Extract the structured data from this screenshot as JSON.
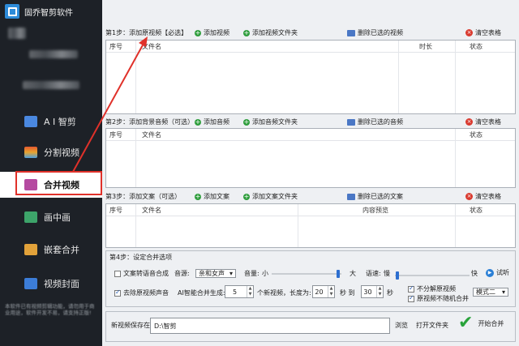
{
  "app": {
    "title": "固乔智剪软件"
  },
  "sidebar": {
    "items": [
      {
        "label": "A I 智剪",
        "icon": "ai-icon",
        "color": "#4a88e0"
      },
      {
        "label": "分割视频",
        "icon": "split-icon",
        "color": "#e6592f"
      },
      {
        "label": "合并视频",
        "icon": "merge-icon",
        "color": "#b54aa0",
        "active": true
      },
      {
        "label": "画中画",
        "icon": "pip-icon",
        "color": "#3da46a"
      },
      {
        "label": "嵌套合并",
        "icon": "nest-icon",
        "color": "#e2a23a"
      },
      {
        "label": "视频封面",
        "icon": "cover-icon",
        "color": "#3c7dd8"
      }
    ],
    "footer": "本软件已有视频剪辑功能，请勿用于商业用途，软件开发不易，请支持正版!"
  },
  "step1": {
    "title": "第1步：添加原视频【必选】",
    "add": "添加视频",
    "add_folder": "添加视频文件夹",
    "delete": "删除已选的视频",
    "clear": "清空表格",
    "columns": [
      "序号",
      "文件名",
      "时长",
      "状态"
    ]
  },
  "step2": {
    "title": "第2步：添加背景音频（可选）",
    "add": "添加音频",
    "add_folder": "添加音频文件夹",
    "delete": "删除已选的音频",
    "clear": "清空表格",
    "columns": [
      "序号",
      "文件名",
      "状态"
    ]
  },
  "step3": {
    "title": "第3步：添加文案（可选）",
    "add": "添加文案",
    "add_folder": "添加文案文件夹",
    "delete": "删除已选的文案",
    "clear": "清空表格",
    "columns": [
      "序号",
      "文件名",
      "内容预览",
      "状态"
    ]
  },
  "step4": {
    "title": "第4步：设定合并选项",
    "tts_label": "文案转语音合成",
    "voice_label": "音源:",
    "voice_value": "亲和女声",
    "volume_label": "音量:",
    "volume_min": "小",
    "volume_max": "大",
    "volume_level": 0.95,
    "speed_label": "语速:",
    "speed_min": "慢",
    "speed_max": "快",
    "speed_level": 0.03,
    "try_label": "试听",
    "remove_audio_label": "去除原视频声音",
    "ai_label": "AI智能合并生成:",
    "count_value": "5",
    "count_unit": "个新视频，长度为:",
    "len_from": "20",
    "len_sep": "秒 到",
    "len_to": "30",
    "len_unit": "秒",
    "no_split_label": "不分解原视频",
    "no_random_label": "原视频不随机合并",
    "mode_value": "模式二"
  },
  "save": {
    "label": "新视频保存在:",
    "path": "D:\\智剪",
    "browse": "浏览",
    "open_folder": "打开文件夹",
    "start": "开始合并"
  },
  "colors": {
    "sidebar_bg": "#1d2127",
    "accent": "#2d6fd0",
    "annotation": "#e0312a"
  }
}
